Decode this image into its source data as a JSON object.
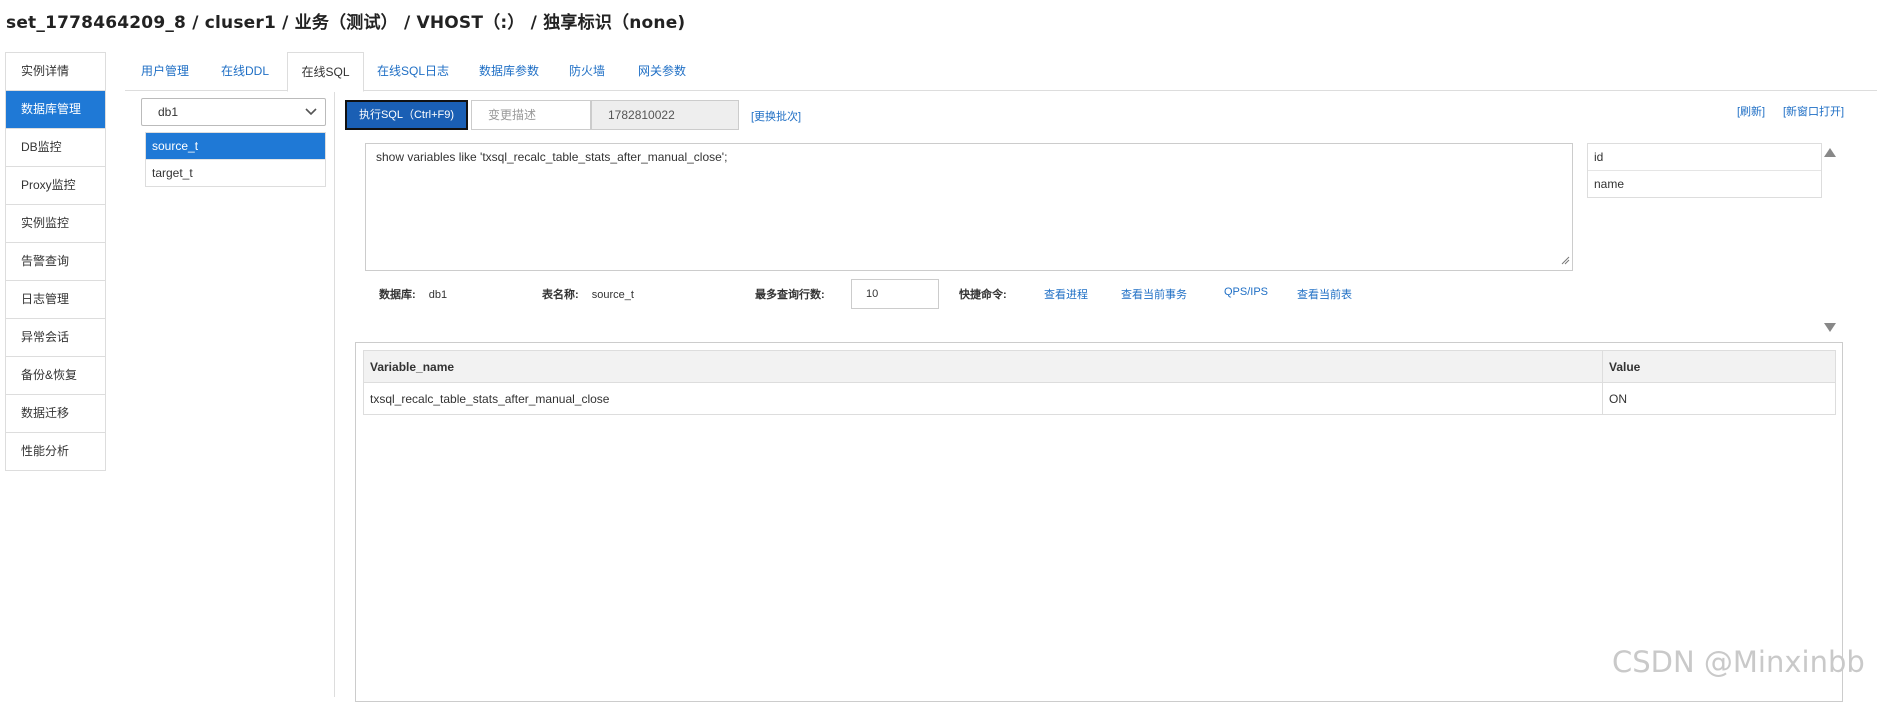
{
  "header": {
    "title": "set_1778464209_8 / cluser1 / 业务（测试） /  VHOST（:） /  独享标识（none)"
  },
  "sidebar": {
    "items": [
      {
        "label": "实例详情"
      },
      {
        "label": "数据库管理"
      },
      {
        "label": "DB监控"
      },
      {
        "label": "Proxy监控"
      },
      {
        "label": "实例监控"
      },
      {
        "label": "告警查询"
      },
      {
        "label": "日志管理"
      },
      {
        "label": "异常会话"
      },
      {
        "label": "备份&恢复"
      },
      {
        "label": "数据迁移"
      },
      {
        "label": "性能分析"
      }
    ]
  },
  "tabs": [
    {
      "label": "用户管理"
    },
    {
      "label": "在线DDL"
    },
    {
      "label": "在线SQL"
    },
    {
      "label": "在线SQL日志"
    },
    {
      "label": "数据库参数"
    },
    {
      "label": "防火墙"
    },
    {
      "label": "网关参数"
    }
  ],
  "db_panel": {
    "selected_db": "db1",
    "tables": [
      "source_t",
      "target_t"
    ]
  },
  "toolbar": {
    "execute_label": "执行SQL（Ctrl+F9)",
    "desc_placeholder": "变更描述",
    "batch_id": "1782810022",
    "change_batch_label": "[更换批次]",
    "refresh_label": "[刷新]",
    "new_window_label": "[新窗口打开]"
  },
  "editor": {
    "sql": "show variables like 'txsql_recalc_table_stats_after_manual_close';"
  },
  "fields": [
    "id",
    "name"
  ],
  "info": {
    "db_label": "数据库:",
    "db_value": "db1",
    "table_label": "表名称:",
    "table_value": "source_t",
    "max_rows_label": "最多查询行数:",
    "max_rows_value": "10",
    "shortcut_label": "快捷命令:",
    "shortcuts": [
      "查看进程",
      "查看当前事务",
      "QPS/IPS",
      "查看当前表"
    ]
  },
  "result": {
    "columns": [
      "Variable_name",
      "Value"
    ],
    "rows": [
      [
        "txsql_recalc_table_stats_after_manual_close",
        "ON"
      ]
    ]
  },
  "watermark": "CSDN @Minxinbb",
  "colors": {
    "accent": "#1f79d6",
    "link": "#1f6fc5",
    "exec_button": "#1a5fb4"
  }
}
